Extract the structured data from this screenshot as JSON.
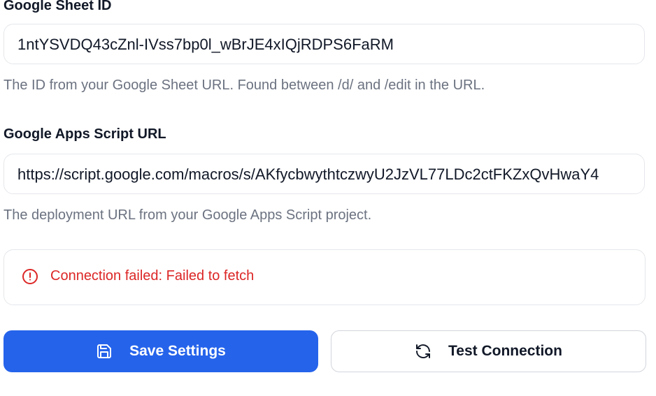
{
  "sheet_id": {
    "label": "Google Sheet ID",
    "value": "1ntYSVDQ43cZnl-IVss7bp0l_wBrJE4xIQjRDPS6FaRM",
    "help": "The ID from your Google Sheet URL. Found between /d/ and /edit in the URL."
  },
  "script_url": {
    "label": "Google Apps Script URL",
    "value": "https://script.google.com/macros/s/AKfycbwythtczwyU2JzVL77LDc2ctFKZxQvHwaY4",
    "help": "The deployment URL from your Google Apps Script project."
  },
  "alert": {
    "message": "Connection failed: Failed to fetch",
    "icon": "alert-circle-icon",
    "color": "#dc2626"
  },
  "buttons": {
    "save_label": "Save Settings",
    "save_icon": "save-icon",
    "test_label": "Test Connection",
    "test_icon": "refresh-icon",
    "primary_color": "#2563eb"
  }
}
